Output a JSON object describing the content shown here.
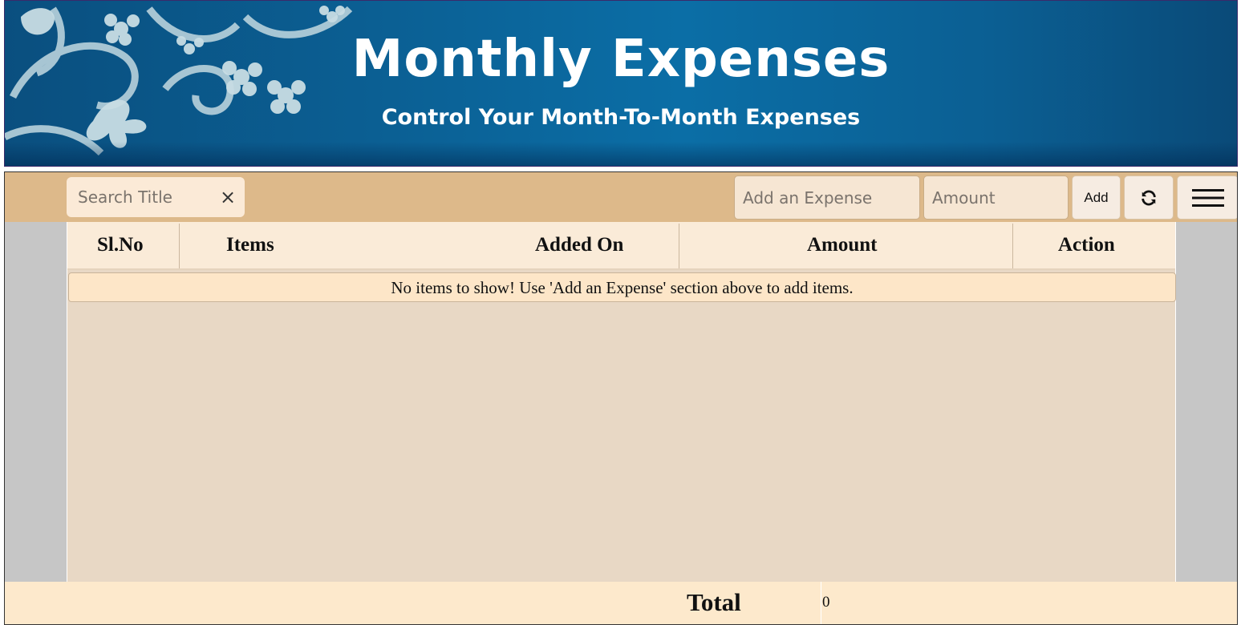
{
  "header": {
    "title": "Monthly Expenses",
    "subtitle": "Control Your Month-To-Month Expenses"
  },
  "toolbar": {
    "search_placeholder": "Search Title",
    "clear_icon": "×",
    "expense_placeholder": "Add an Expense",
    "amount_placeholder": "Amount",
    "add_label": "Add",
    "refresh_icon": "refresh-icon",
    "menu_icon": "hamburger-menu-icon"
  },
  "table": {
    "columns": [
      "Sl.No",
      "Items",
      "Added On",
      "Amount",
      "Action"
    ],
    "empty_message": "No items to show! Use 'Add an Expense' section above to add items."
  },
  "footer": {
    "total_label": "Total",
    "total_value": "0"
  },
  "colors": {
    "banner": "#0b6ea6",
    "toolbar": "#ddb98a",
    "table_body": "#e8d8c5",
    "header_row": "#faebd8",
    "footer": "#fde9cc"
  }
}
